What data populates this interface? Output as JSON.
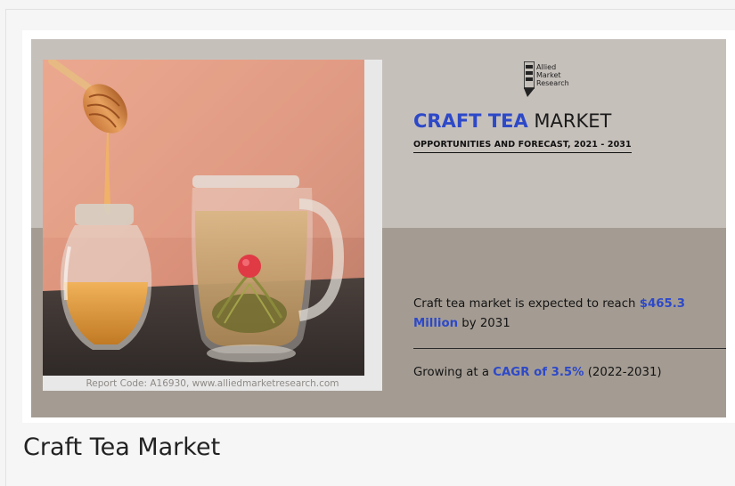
{
  "figure": {
    "image_alt": "Craft Tea Market",
    "report_code": "Report Code: A16930, www.alliedmarketresearch.com",
    "logo": {
      "lines": [
        "Allied",
        "Market",
        "Research"
      ],
      "icon": "allied-market-research-logo-icon"
    },
    "title": {
      "accent": "CRAFT TEA",
      "rest": " MARKET"
    },
    "subtitle": "OPPORTUNITIES AND FORECAST, 2021 - 2031",
    "stat1": {
      "before": "Craft tea market is expected to reach ",
      "highlight": "$465.3 Million",
      "after": " by 2031"
    },
    "stat2": {
      "before": "Growing at a ",
      "highlight": "CAGR of 3.5%",
      "after": " (2022-2031)"
    },
    "colors": {
      "accent": "#2d49c8",
      "panel_top": "#c6c0bb",
      "panel_bottom": "#a49c93"
    },
    "photo": {
      "subject": "honey jar with dipper and glass mug of blooming flower tea",
      "icon": "tea-photo"
    }
  },
  "caption": "Craft Tea Market"
}
